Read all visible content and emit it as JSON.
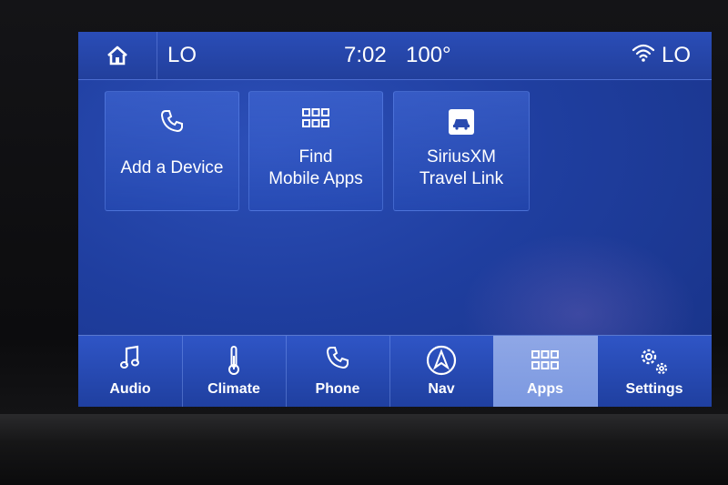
{
  "status_bar": {
    "home_icon": "home-icon",
    "left_temp": "LO",
    "time": "7:02",
    "outside_temp": "100°",
    "wifi_icon": "wifi-icon",
    "right_temp": "LO"
  },
  "tiles": [
    {
      "icon": "phone-icon",
      "label_lines": [
        "Add a Device"
      ]
    },
    {
      "icon": "grid-apps-icon",
      "label_lines": [
        "Find",
        "Mobile Apps"
      ]
    },
    {
      "icon": "siriusxm-icon",
      "label_lines": [
        "SiriusXM",
        "Travel Link"
      ]
    }
  ],
  "nav": {
    "active": "Apps",
    "items": [
      {
        "icon": "music-note-icon",
        "label": "Audio"
      },
      {
        "icon": "thermometer-icon",
        "label": "Climate"
      },
      {
        "icon": "phone-icon",
        "label": "Phone"
      },
      {
        "icon": "navigation-arrow-icon",
        "label": "Nav"
      },
      {
        "icon": "grid-apps-icon",
        "label": "Apps"
      },
      {
        "icon": "settings-gears-icon",
        "label": "Settings"
      }
    ]
  },
  "colors": {
    "screen_blue": "#1f3e9f",
    "active_tab": "#8fa7e6",
    "text": "#ffffff"
  }
}
